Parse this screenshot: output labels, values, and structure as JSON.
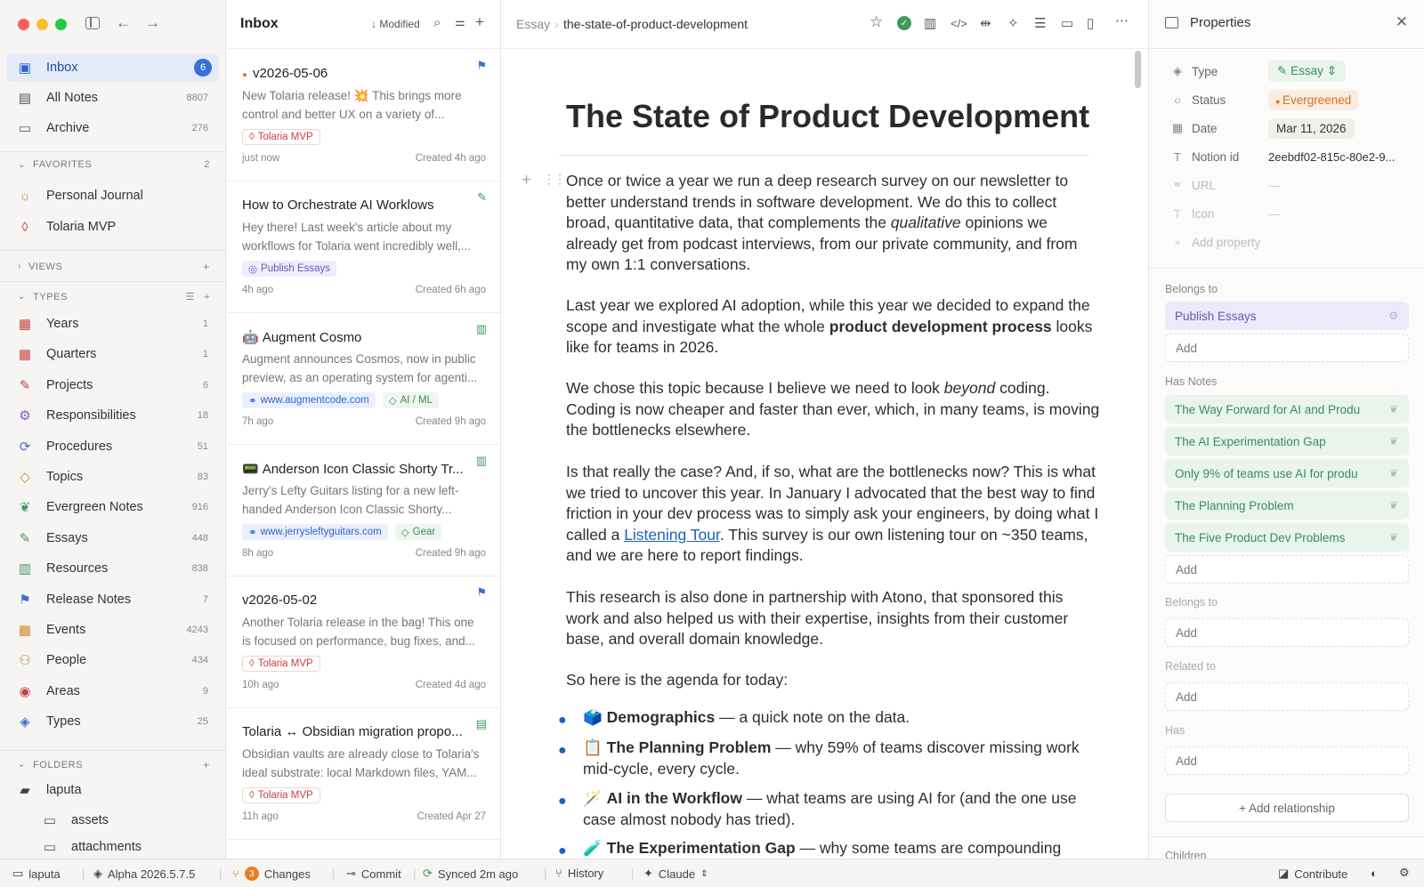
{
  "window": {
    "traffic": [
      "close",
      "minimize",
      "zoom"
    ]
  },
  "sidebar": {
    "top": [
      {
        "label": "Inbox",
        "count": "6",
        "icon": "inbox-icon",
        "active": true
      },
      {
        "label": "All Notes",
        "count": "8807",
        "icon": "notes-icon"
      },
      {
        "label": "Archive",
        "count": "276",
        "icon": "archive-icon"
      }
    ],
    "favorites_label": "FAVORITES",
    "favorites_count": "2",
    "favorites": [
      {
        "label": "Personal Journal",
        "icon": "sun-icon"
      },
      {
        "label": "Tolaria MVP",
        "icon": "drop-icon"
      }
    ],
    "views_label": "VIEWS",
    "types_label": "TYPES",
    "types": [
      {
        "label": "Years",
        "count": "1",
        "icon": "calendar-icon",
        "color": "#c94040"
      },
      {
        "label": "Quarters",
        "count": "1",
        "icon": "calendar-icon",
        "color": "#c94040"
      },
      {
        "label": "Projects",
        "count": "6",
        "icon": "wrench-icon",
        "color": "#c94040"
      },
      {
        "label": "Responsibilities",
        "count": "18",
        "icon": "gear-icon",
        "color": "#7b5cc8"
      },
      {
        "label": "Procedures",
        "count": "51",
        "icon": "loop-icon",
        "color": "#3f6fd0"
      },
      {
        "label": "Topics",
        "count": "83",
        "icon": "tag-icon",
        "color": "#d08a2a"
      },
      {
        "label": "Evergreen Notes",
        "count": "916",
        "icon": "leaf-icon",
        "color": "#3f9a5f"
      },
      {
        "label": "Essays",
        "count": "448",
        "icon": "pen-icon",
        "color": "#3f9a5f"
      },
      {
        "label": "Resources",
        "count": "838",
        "icon": "book-icon",
        "color": "#3f9a5f"
      },
      {
        "label": "Release Notes",
        "count": "7",
        "icon": "flag-icon",
        "color": "#3f6fd0"
      },
      {
        "label": "Events",
        "count": "4243",
        "icon": "calendar-icon",
        "color": "#d08a2a"
      },
      {
        "label": "People",
        "count": "434",
        "icon": "people-icon",
        "color": "#d08a2a"
      },
      {
        "label": "Areas",
        "count": "9",
        "icon": "palette-icon",
        "color": "#c94040"
      },
      {
        "label": "Types",
        "count": "25",
        "icon": "layers-icon",
        "color": "#3f6fd0"
      }
    ],
    "folders_label": "FOLDERS",
    "folders": [
      {
        "label": "laputa"
      },
      {
        "label": "assets"
      },
      {
        "label": "attachments"
      }
    ]
  },
  "list": {
    "title": "Inbox",
    "sort_label": "Modified",
    "cards": [
      {
        "title": "v2026-05-06",
        "snippet": "New Tolaria release! 💥 This brings more control and better UX on a variety of...",
        "tags": [
          {
            "label": "Tolaria MVP",
            "kind": "red"
          }
        ],
        "ago": "just now",
        "created": "Created 4h ago",
        "icon": "flag-icon",
        "dot": true
      },
      {
        "title": "How to Orchestrate AI Worklows",
        "snippet": "Hey there! Last week's article about my workflows for Tolaria went incredibly well,...",
        "tags": [
          {
            "label": "Publish Essays",
            "kind": "purple"
          }
        ],
        "ago": "4h ago",
        "created": "Created 6h ago",
        "icon": "pen-icon"
      },
      {
        "title": "Augment Cosmo",
        "snippet": "Augment announces Cosmos, now in public preview, as an operating system for agenti...",
        "tags": [
          {
            "label": "www.augmentcode.com",
            "kind": "blue"
          },
          {
            "label": "AI / ML",
            "kind": "green"
          }
        ],
        "ago": "7h ago",
        "created": "Created 9h ago",
        "icon": "book-icon",
        "emoji": "🤖"
      },
      {
        "title": "Anderson Icon Classic Shorty Tr...",
        "snippet": "Jerry's Lefty Guitars listing for a new left-handed Anderson Icon Classic Shorty...",
        "tags": [
          {
            "label": "www.jerrysleftyguitars.com",
            "kind": "blue"
          },
          {
            "label": "Gear",
            "kind": "green"
          }
        ],
        "ago": "8h ago",
        "created": "Created 9h ago",
        "icon": "book-icon",
        "emoji": "📟"
      },
      {
        "title": "v2026-05-02",
        "snippet": "Another Tolaria release in the bag! This one is focused on performance, bug fixes, and...",
        "tags": [
          {
            "label": "Tolaria MVP",
            "kind": "red"
          }
        ],
        "ago": "10h ago",
        "created": "Created 4d ago",
        "icon": "flag-icon"
      },
      {
        "title": "Tolaria ↔ Obsidian migration propo...",
        "snippet": "Obsidian vaults are already close to Tolaria's ideal substrate: local Markdown files, YAM...",
        "tags": [
          {
            "label": "Tolaria MVP",
            "kind": "red"
          }
        ],
        "ago": "11h ago",
        "created": "Created Apr 27",
        "icon": "doc-icon"
      }
    ]
  },
  "editor": {
    "crumb_type": "Essay",
    "crumb_file": "the-state-of-product-development",
    "title": "The State of Product Development",
    "p1a": "Once or twice a year we run a deep research survey on our newsletter to better understand trends in software development. We do this to collect broad, quantitative data, that complements the ",
    "p1_em": "qualitative",
    "p1b": " opinions we already get from podcast interviews, from our private community, and from my own 1:1 conversations.",
    "p2a": "Last year we explored AI adoption, while this year we decided to expand the scope and investigate what the whole ",
    "p2_strong": "product development process",
    "p2b": " looks like for teams in 2026.",
    "p3a": "We chose this topic because I believe we need to look ",
    "p3_em": "beyond",
    "p3b": " coding. Coding is now cheaper and faster than ever, which, in many teams, is moving the bottlenecks elsewhere.",
    "p4a": "Is that really the case? And, if so, what are the bottlenecks now? This is what we tried to uncover this year. In January I advocated that the best way to find friction in your dev process was to simply ask your engineers, by doing what I called a ",
    "p4_link": "Listening Tour",
    "p4b": ". This survey is our own listening tour on ~350 teams, and we are here to report findings.",
    "p5": "This research is also done in partnership with Atono, that sponsored this work and also helped us with their expertise, insights from their customer base, and overall domain knowledge.",
    "p6": "So here is the agenda for today:",
    "bullets": [
      {
        "emoji": "🗳️",
        "strong": "Demographics",
        "rest": " — a quick note on the data."
      },
      {
        "emoji": "📋",
        "strong": "The Planning Problem",
        "rest": " — why 59% of teams discover missing work mid-cycle, every cycle."
      },
      {
        "emoji": "🪄",
        "strong": "AI in the Workflow",
        "rest": " — what teams are using AI for (and the one use case almost nobody has tried)."
      },
      {
        "emoji": "🧪",
        "strong": "The Experimentation Gap",
        "rest": " — why some teams are compounding"
      }
    ]
  },
  "props": {
    "title": "Properties",
    "rows": [
      {
        "label": "Type",
        "value": "Essay",
        "icon": "layers-icon"
      },
      {
        "label": "Status",
        "value": "Evergreened",
        "icon": "circle-icon"
      },
      {
        "label": "Date",
        "value": "Mar 11, 2026",
        "icon": "calendar-icon"
      },
      {
        "label": "Notion id",
        "value": "2eebdf02-815c-80e2-9...",
        "icon": "text-icon"
      },
      {
        "label": "URL",
        "value": "—",
        "icon": "link-icon"
      },
      {
        "label": "Icon",
        "value": "—",
        "icon": "text-icon"
      }
    ],
    "add_property": "Add property",
    "belongs_to": "Belongs to",
    "belongs_items": [
      "Publish Essays"
    ],
    "has_notes": "Has Notes",
    "has_notes_items": [
      "The Way Forward for AI and Produ",
      "The AI Experimentation Gap",
      "Only 9% of teams use AI for produ",
      "The Planning Problem",
      "The Five Product Dev Problems"
    ],
    "belongs_to2": "Belongs to",
    "related_to": "Related to",
    "has": "Has",
    "add": "Add",
    "add_relationship": "+ Add relationship",
    "children": "Children"
  },
  "status": {
    "vault": "laputa",
    "version": "Alpha 2026.5.7.5",
    "changes_count": "3",
    "changes": "Changes",
    "commit": "Commit",
    "synced": "Synced 2m ago",
    "history": "History",
    "ai": "Claude",
    "contribute": "Contribute"
  },
  "colors": {
    "accent": "#3b6fd6",
    "inbox_bg": "#e4eaf6",
    "green_rel": "#e8f4ec",
    "status_orange": "#d9731f"
  }
}
